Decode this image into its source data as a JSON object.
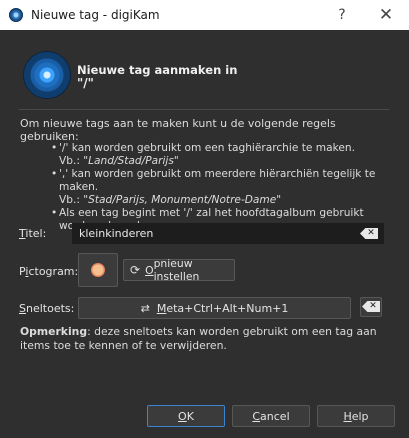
{
  "window": {
    "title": "Nieuwe tag - digiKam",
    "help_glyph": "?",
    "close_glyph": "✕"
  },
  "header": {
    "title": "Nieuwe tag aanmaken in",
    "path": "\"/\""
  },
  "intro": "Om nieuwe tags aan te maken kunt u de volgende regels gebruiken:",
  "rules": [
    {
      "bullet": "•",
      "text": "'/' kan worden gebruikt om een taghiërarchie te maken.",
      "ex_label": "Vb.: ",
      "ex_value": "\"Land/Stad/Parijs\""
    },
    {
      "bullet": "•",
      "text": "',' kan worden gebruikt om meerdere hiërarchiën tegelijk te maken.",
      "ex_label": "Vb.: ",
      "ex_value": "\"Stad/Parijs, Monument/Notre-Dame\""
    },
    {
      "bullet": "•",
      "text": "Als een tag begint met '/' zal het hoofdtagalbum gebruikt worden als ouder."
    }
  ],
  "form": {
    "title_label_mn": "T",
    "title_label_rest": "itel:",
    "title_value": "kleinkinderen",
    "icon_label_pre": "P",
    "icon_label_mn": "i",
    "icon_label_rest": "ctogram:",
    "reset_label_mn": "O",
    "reset_label_rest": "pnieuw instellen",
    "shortcut_label_mn": "S",
    "shortcut_label_rest": "neltoets:",
    "shortcut_value_mn": "M",
    "shortcut_value_rest": "eta+Ctrl+Alt+Num+1"
  },
  "note": {
    "bold": "Opmerking",
    "text": ": deze sneltoets kan worden gebruikt om een tag aan items toe te kennen of te verwijderen."
  },
  "buttons": {
    "ok_mn": "O",
    "ok_rest": "K",
    "cancel_mn": "C",
    "cancel_rest": "ancel",
    "help_mn": "H",
    "help_rest": "elp"
  },
  "colors": {
    "background": "#2f2f30",
    "accent": "#3b85d0"
  },
  "icons": {
    "app": "digikam-icon",
    "header": "tag-new-icon",
    "tag": "face-emoji-icon",
    "reset": "reset-icon",
    "shortcut": "shortcut-icon",
    "clear": "clear-icon"
  }
}
